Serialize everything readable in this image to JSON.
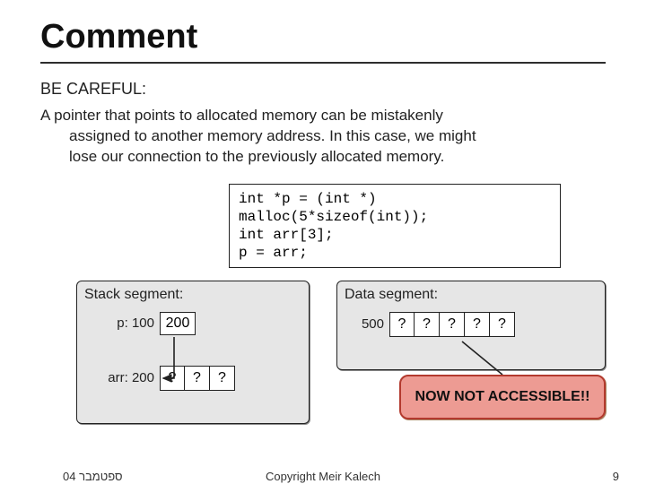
{
  "title": "Comment",
  "subtitle": "BE CAREFUL:",
  "body_line1": "A pointer that points to allocated memory can be mistakenly",
  "body_line2": "assigned to another memory address. In this case, we might",
  "body_line3": "lose our connection to the previously allocated memory.",
  "code": {
    "l1": "int *p = (int *) malloc(5*sizeof(int));",
    "l2": "int arr[3];",
    "l3": "p = arr;"
  },
  "stack": {
    "label": "Stack segment:",
    "p_label": "p: 100",
    "p_value": "200",
    "arr_label": "arr: 200",
    "arr_q": [
      "?",
      "?",
      "?"
    ]
  },
  "dataseg": {
    "label": "Data segment:",
    "addr": "500",
    "q": [
      "?",
      "?",
      "?",
      "?",
      "?"
    ]
  },
  "warn": "NOW NOT ACCESSIBLE!!",
  "footer": {
    "date": "ספטמבר 04",
    "copyright": "Copyright Meir Kalech",
    "pageno": "9"
  }
}
